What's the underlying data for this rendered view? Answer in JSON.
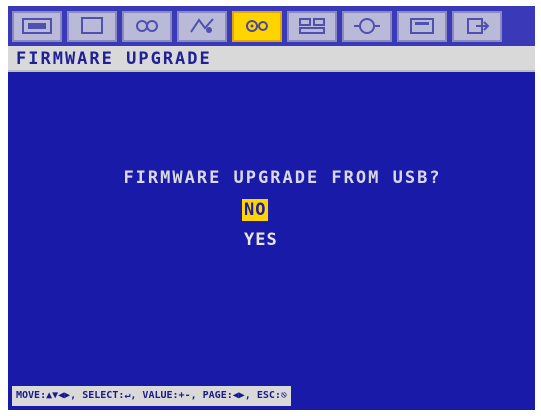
{
  "toolbar": {
    "icons": [
      {
        "name": "record-icon"
      },
      {
        "name": "display-icon"
      },
      {
        "name": "camera-icon"
      },
      {
        "name": "alarm-icon"
      },
      {
        "name": "system-settings-icon"
      },
      {
        "name": "network-icon"
      },
      {
        "name": "event-icon"
      },
      {
        "name": "storage-icon"
      },
      {
        "name": "exit-icon"
      }
    ],
    "active_index": 4
  },
  "title": "FIRMWARE UPGRADE",
  "dialog": {
    "question": "FIRMWARE UPGRADE FROM USB?",
    "options": [
      "NO",
      "YES"
    ],
    "selected": "NO"
  },
  "help": "MOVE:▲▼◀▶, SELECT:↵, VALUE:+-, PAGE:◀▶, ESC:⎋",
  "colors": {
    "background": "#1a1aa8",
    "highlight": "#ffd400",
    "titlebar": "#d9d9d9"
  }
}
